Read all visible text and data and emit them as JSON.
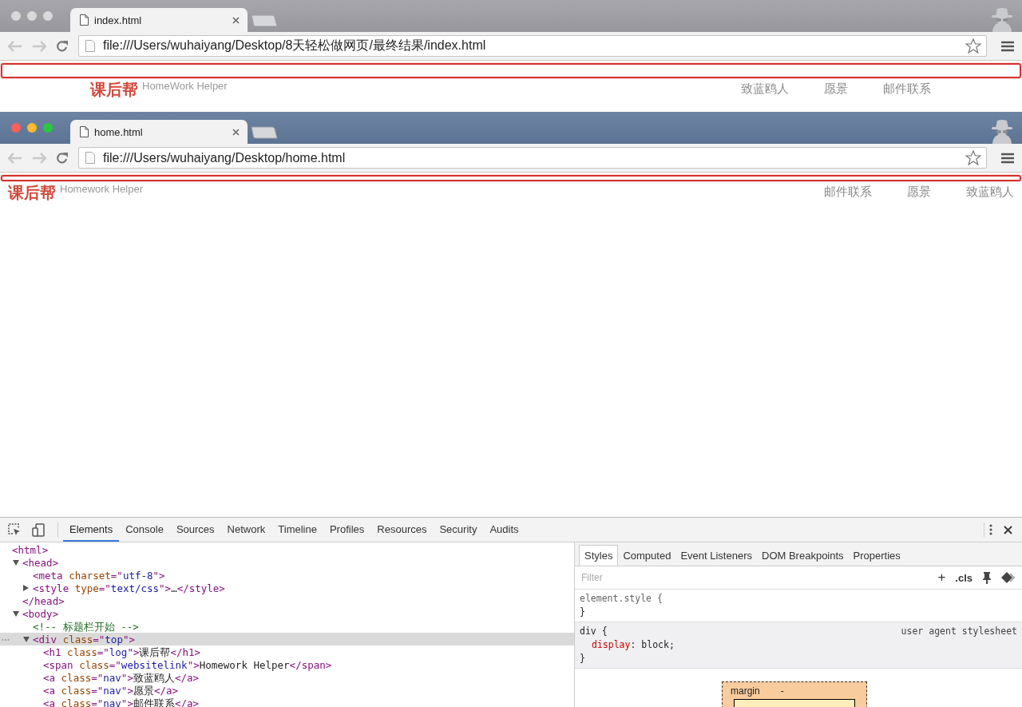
{
  "windows": [
    {
      "active": false,
      "kind": "centered",
      "tab": {
        "title": "index.html"
      },
      "url": "file:///Users/wuhaiyang/Desktop/8天轻松做网页/最终结果/index.html",
      "highlight": true,
      "page": {
        "logo": "课后帮",
        "tagline": "HomeWork Helper",
        "nav": [
          "致蓝鸥人",
          "愿景",
          "邮件联系"
        ]
      }
    },
    {
      "active": true,
      "kind": "full",
      "tab": {
        "title": "home.html"
      },
      "url": "file:///Users/wuhaiyang/Desktop/home.html",
      "highlight": true,
      "page": {
        "logo": "课后帮",
        "tagline": "Homework Helper",
        "nav": [
          "邮件联系",
          "愿景",
          "致蓝鸥人"
        ]
      }
    }
  ],
  "devtools": {
    "tabs": [
      {
        "label": "Elements",
        "selected": true
      },
      {
        "label": "Console",
        "selected": false
      },
      {
        "label": "Sources",
        "selected": false
      },
      {
        "label": "Network",
        "selected": false
      },
      {
        "label": "Timeline",
        "selected": false
      },
      {
        "label": "Profiles",
        "selected": false
      },
      {
        "label": "Resources",
        "selected": false
      },
      {
        "label": "Security",
        "selected": false
      },
      {
        "label": "Audits",
        "selected": false
      }
    ],
    "dom": [
      {
        "selected": false,
        "parts": [
          {
            "kind": "tag",
            "text": "<html>"
          }
        ],
        "children": [
          {
            "selected": false,
            "expanded": true,
            "parts": [
              {
                "kind": "tag",
                "text": "<head>"
              }
            ],
            "children": [
              {
                "selected": false,
                "parts": [
                  {
                    "kind": "tag",
                    "text": "<meta "
                  },
                  {
                    "kind": "attr",
                    "text": "charset"
                  },
                  {
                    "kind": "tag",
                    "text": "=\""
                  },
                  {
                    "kind": "value",
                    "text": "utf-8"
                  },
                  {
                    "kind": "tag",
                    "text": "\">"
                  }
                ]
              },
              {
                "selected": false,
                "expanded": false,
                "parts": [
                  {
                    "kind": "tag",
                    "text": "<style "
                  },
                  {
                    "kind": "attr",
                    "text": "type"
                  },
                  {
                    "kind": "tag",
                    "text": "=\""
                  },
                  {
                    "kind": "value",
                    "text": "text/css"
                  },
                  {
                    "kind": "tag",
                    "text": "\">"
                  },
                  {
                    "kind": "text",
                    "text": "…"
                  },
                  {
                    "kind": "tag",
                    "text": "</style>"
                  }
                ]
              }
            ]
          },
          {
            "selected": false,
            "parts": [
              {
                "kind": "tag",
                "text": "</head>"
              }
            ]
          },
          {
            "selected": false,
            "expanded": true,
            "parts": [
              {
                "kind": "tag",
                "text": "<body>"
              }
            ],
            "children": [
              {
                "selected": false,
                "parts": [
                  {
                    "kind": "comment",
                    "text": "<!-- 标题栏开始 -->"
                  }
                ]
              },
              {
                "selected": true,
                "expanded": true,
                "parts": [
                  {
                    "kind": "tag",
                    "text": "<div "
                  },
                  {
                    "kind": "attr",
                    "text": "class"
                  },
                  {
                    "kind": "tag",
                    "text": "=\""
                  },
                  {
                    "kind": "value",
                    "text": "top"
                  },
                  {
                    "kind": "tag",
                    "text": "\">"
                  }
                ],
                "children": [
                  {
                    "selected": false,
                    "parts": [
                      {
                        "kind": "tag",
                        "text": "<h1 "
                      },
                      {
                        "kind": "attr",
                        "text": "class"
                      },
                      {
                        "kind": "tag",
                        "text": "=\""
                      },
                      {
                        "kind": "value",
                        "text": "log"
                      },
                      {
                        "kind": "tag",
                        "text": "\">"
                      },
                      {
                        "kind": "text",
                        "text": "课后帮"
                      },
                      {
                        "kind": "tag",
                        "text": "</h1>"
                      }
                    ]
                  },
                  {
                    "selected": false,
                    "parts": [
                      {
                        "kind": "tag",
                        "text": "<span "
                      },
                      {
                        "kind": "attr",
                        "text": "class"
                      },
                      {
                        "kind": "tag",
                        "text": "=\""
                      },
                      {
                        "kind": "value",
                        "text": "websitelink"
                      },
                      {
                        "kind": "tag",
                        "text": "\">"
                      },
                      {
                        "kind": "text",
                        "text": "Homework Helper"
                      },
                      {
                        "kind": "tag",
                        "text": "</span>"
                      }
                    ]
                  },
                  {
                    "selected": false,
                    "parts": [
                      {
                        "kind": "tag",
                        "text": "<a "
                      },
                      {
                        "kind": "attr",
                        "text": "class"
                      },
                      {
                        "kind": "tag",
                        "text": "=\""
                      },
                      {
                        "kind": "value",
                        "text": "nav"
                      },
                      {
                        "kind": "tag",
                        "text": "\">"
                      },
                      {
                        "kind": "text",
                        "text": "致蓝鸥人"
                      },
                      {
                        "kind": "tag",
                        "text": "</a>"
                      }
                    ]
                  },
                  {
                    "selected": false,
                    "parts": [
                      {
                        "kind": "tag",
                        "text": "<a "
                      },
                      {
                        "kind": "attr",
                        "text": "class"
                      },
                      {
                        "kind": "tag",
                        "text": "=\""
                      },
                      {
                        "kind": "value",
                        "text": "nav"
                      },
                      {
                        "kind": "tag",
                        "text": "\">"
                      },
                      {
                        "kind": "text",
                        "text": "愿景"
                      },
                      {
                        "kind": "tag",
                        "text": "</a>"
                      }
                    ]
                  },
                  {
                    "selected": false,
                    "parts": [
                      {
                        "kind": "tag",
                        "text": "<a "
                      },
                      {
                        "kind": "attr",
                        "text": "class"
                      },
                      {
                        "kind": "tag",
                        "text": "=\""
                      },
                      {
                        "kind": "value",
                        "text": "nav"
                      },
                      {
                        "kind": "tag",
                        "text": "\">"
                      },
                      {
                        "kind": "text",
                        "text": "邮件联系"
                      },
                      {
                        "kind": "tag",
                        "text": "</a>"
                      }
                    ]
                  }
                ]
              }
            ]
          }
        ]
      }
    ],
    "styles": {
      "tabs": [
        {
          "label": "Styles",
          "selected": true
        },
        {
          "label": "Computed",
          "selected": false
        },
        {
          "label": "Event Listeners",
          "selected": false
        },
        {
          "label": "DOM Breakpoints",
          "selected": false
        },
        {
          "label": "Properties",
          "selected": false
        }
      ],
      "filter_placeholder": "Filter",
      "add": "+",
      "cls": ".cls",
      "rules": [
        {
          "selector": "element.style {",
          "shaded": false,
          "close": "}"
        },
        {
          "selector": "div {",
          "source": "user agent stylesheet",
          "shaded": true,
          "declarations": [
            {
              "property": "display",
              "value": ": block;"
            }
          ],
          "close": "}"
        }
      ],
      "box_model": {
        "label": "margin",
        "value": "-"
      }
    }
  }
}
